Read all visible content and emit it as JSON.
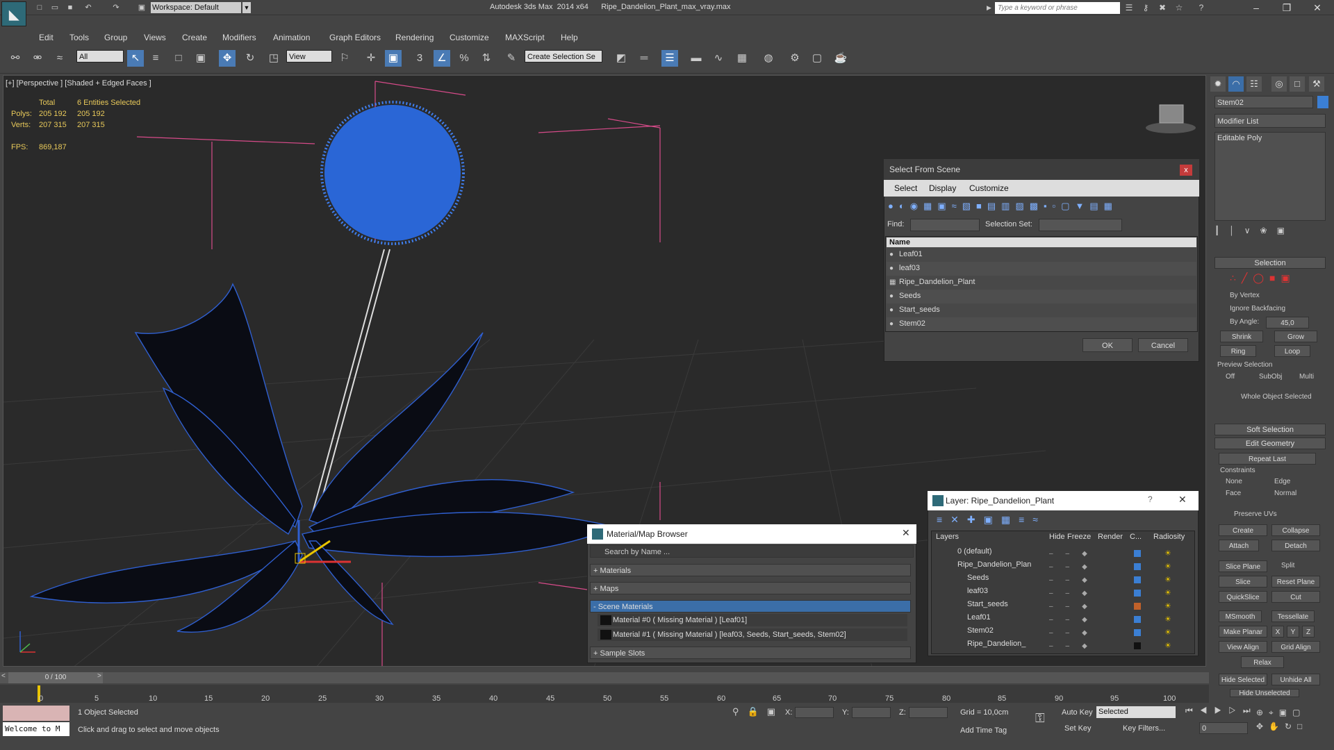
{
  "title_bar": {
    "workspace": "Workspace: Default",
    "app_title": "Autodesk 3ds Max  2014 x64      Ripe_Dandelion_Plant_max_vray.max",
    "search_placeholder": "Type a keyword or phrase"
  },
  "menu": [
    "Edit",
    "Tools",
    "Group",
    "Views",
    "Create",
    "Modifiers",
    "Animation",
    "Graph Editors",
    "Rendering",
    "Customize",
    "MAXScript",
    "Help"
  ],
  "toolbar": {
    "filter": "All",
    "refcoord": "View",
    "selection_set": "Create Selection Se"
  },
  "viewport": {
    "label": "[+] [Perspective ] [Shaded + Edged Faces ]",
    "stats": {
      "total_label": "Total",
      "selected_label": "6 Entities Selected",
      "polys_label": "Polys:",
      "polys_total": "205 192",
      "polys_sel": "205 192",
      "verts_label": "Verts:",
      "verts_total": "207 315",
      "verts_sel": "207 315",
      "fps_label": "FPS:",
      "fps": "869,187"
    }
  },
  "command_panel": {
    "object_name": "Stem02",
    "modifier_list": "Modifier List",
    "stack_item": "Editable Poly",
    "selection": {
      "header": "Selection",
      "by_vertex": "By Vertex",
      "ignore_backfacing": "Ignore Backfacing",
      "by_angle": "By Angle:",
      "angle": "45,0",
      "shrink": "Shrink",
      "grow": "Grow",
      "ring": "Ring",
      "loop": "Loop",
      "preview": "Preview Selection",
      "off": "Off",
      "subobj": "SubObj",
      "multi": "Multi",
      "whole": "Whole Object Selected"
    },
    "soft_selection": "Soft Selection",
    "edit_geometry": {
      "header": "Edit Geometry",
      "repeat_last": "Repeat Last",
      "constraints": "Constraints",
      "none": "None",
      "edge": "Edge",
      "face": "Face",
      "normal": "Normal",
      "preserve_uvs": "Preserve UVs",
      "create": "Create",
      "collapse": "Collapse",
      "attach": "Attach",
      "detach": "Detach",
      "slice_plane": "Slice Plane",
      "split": "Split",
      "slice": "Slice",
      "reset_plane": "Reset Plane",
      "quickslice": "QuickSlice",
      "cut": "Cut",
      "msmooth": "MSmooth",
      "tessellate": "Tessellate",
      "make_planar": "Make Planar",
      "x": "X",
      "y": "Y",
      "z": "Z",
      "view_align": "View Align",
      "grid_align": "Grid Align",
      "relax": "Relax",
      "hide_selected": "Hide Selected",
      "unhide_all": "Unhide All",
      "hide_unselected": "Hide Unselected"
    }
  },
  "select_from_scene": {
    "title": "Select From Scene",
    "menu": [
      "Select",
      "Display",
      "Customize"
    ],
    "find_label": "Find:",
    "selection_set_label": "Selection Set:",
    "column": "Name",
    "items": [
      "Leaf01",
      "leaf03",
      "Ripe_Dandelion_Plant",
      "Seeds",
      "Start_seeds",
      "Stem02"
    ],
    "ok": "OK",
    "cancel": "Cancel"
  },
  "material_browser": {
    "title": "Material/Map Browser",
    "search_placeholder": "Search by Name ...",
    "groups": [
      "+ Materials",
      "+ Maps",
      "- Scene Materials"
    ],
    "materials": [
      "Material #0  ( Missing Material )  [Leaf01]",
      "Material #1  ( Missing Material )  [leaf03, Seeds, Start_seeds, Stem02]"
    ],
    "sample_slots": "+ Sample Slots"
  },
  "layer_dialog": {
    "title": "Layer: Ripe_Dandelion_Plant",
    "help": "?",
    "columns": [
      "Layers",
      "Hide",
      "Freeze",
      "Render",
      "C...",
      "Radiosity"
    ],
    "rows": [
      {
        "name": "0 (default)",
        "color": "#3b7fd4"
      },
      {
        "name": "Ripe_Dandelion_Plan",
        "color": "#3b7fd4"
      },
      {
        "name": "Seeds",
        "color": "#3b7fd4"
      },
      {
        "name": "leaf03",
        "color": "#3b7fd4"
      },
      {
        "name": "Start_seeds",
        "color": "#c0612a"
      },
      {
        "name": "Leaf01",
        "color": "#3b7fd4"
      },
      {
        "name": "Stem02",
        "color": "#3b7fd4"
      },
      {
        "name": "Ripe_Dandelion_",
        "color": "#111111"
      }
    ]
  },
  "timeline": {
    "slider": "0 / 100",
    "ticks": [
      "0",
      "5",
      "10",
      "15",
      "20",
      "25",
      "30",
      "35",
      "40",
      "45",
      "50",
      "55",
      "60",
      "65",
      "70",
      "75",
      "80",
      "85",
      "90",
      "95",
      "100"
    ]
  },
  "status": {
    "maxscript": "Welcome to M",
    "selected": "1 Object Selected",
    "prompt": "Click and drag to select and move objects",
    "x_label": "X:",
    "y_label": "Y:",
    "z_label": "Z:",
    "grid": "Grid = 10,0cm",
    "add_time_tag": "Add Time Tag",
    "auto_key": "Auto Key",
    "set_key": "Set Key",
    "key_mode": "Selected",
    "key_filters": "Key Filters...",
    "frame": "0"
  }
}
